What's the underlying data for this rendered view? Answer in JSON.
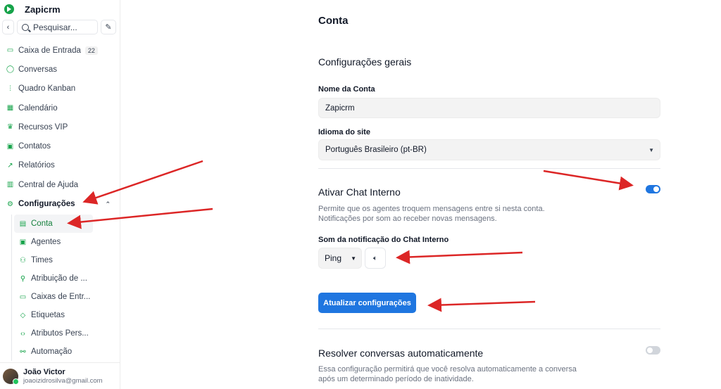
{
  "sidebar": {
    "brand": "Zapicrm",
    "search_placeholder": "Pesquisar...",
    "items": [
      {
        "label": "Caixa de Entrada",
        "icon": "inbox-icon",
        "badge": "22"
      },
      {
        "label": "Conversas",
        "icon": "chat-bubble-icon"
      },
      {
        "label": "Quadro Kanban",
        "icon": "kanban-icon"
      },
      {
        "label": "Calendário",
        "icon": "calendar-icon"
      },
      {
        "label": "Recursos VIP",
        "icon": "crown-icon"
      },
      {
        "label": "Contatos",
        "icon": "contact-card-icon"
      },
      {
        "label": "Relatórios",
        "icon": "chart-line-icon"
      },
      {
        "label": "Central de Ajuda",
        "icon": "book-icon"
      },
      {
        "label": "Configurações",
        "icon": "gear-icon"
      }
    ],
    "subitems": [
      {
        "label": "Conta",
        "icon": "briefcase-icon"
      },
      {
        "label": "Agentes",
        "icon": "agent-card-icon"
      },
      {
        "label": "Times",
        "icon": "team-icon"
      },
      {
        "label": "Atribuição de ...",
        "icon": "user-assign-icon"
      },
      {
        "label": "Caixas de Entr...",
        "icon": "inbox-icon"
      },
      {
        "label": "Etiquetas",
        "icon": "tag-icon"
      },
      {
        "label": "Atributos Pers...",
        "icon": "code-brackets-icon"
      },
      {
        "label": "Automação",
        "icon": "automation-icon"
      }
    ],
    "user": {
      "name": "João Victor",
      "email": "joaoizidrosilva@gmail.com"
    }
  },
  "main": {
    "page_title": "Conta",
    "general": {
      "title": "Configurações gerais",
      "account_name_label": "Nome da Conta",
      "account_name_value": "Zapicrm",
      "language_label": "Idioma do site",
      "language_value": "Português Brasileiro (pt-BR)"
    },
    "chat": {
      "title": "Ativar Chat Interno",
      "enabled": true,
      "desc_line1": "Permite que os agentes troquem mensagens entre si nesta conta.",
      "desc_line2": "Notificações por som ao receber novas mensagens.",
      "sound_label": "Som da notificação do Chat Interno",
      "sound_value": "Ping",
      "update_button": "Atualizar configurações"
    },
    "resolve": {
      "title": "Resolver conversas automaticamente",
      "enabled": false,
      "desc_line1": "Essa configuração permitirá que você resolva automaticamente a conversa",
      "desc_line2": "após um determinado período de inatividade."
    }
  },
  "colors": {
    "accent": "#1f76e0",
    "brand": "#16a34a",
    "annotation": "#dc2626"
  }
}
